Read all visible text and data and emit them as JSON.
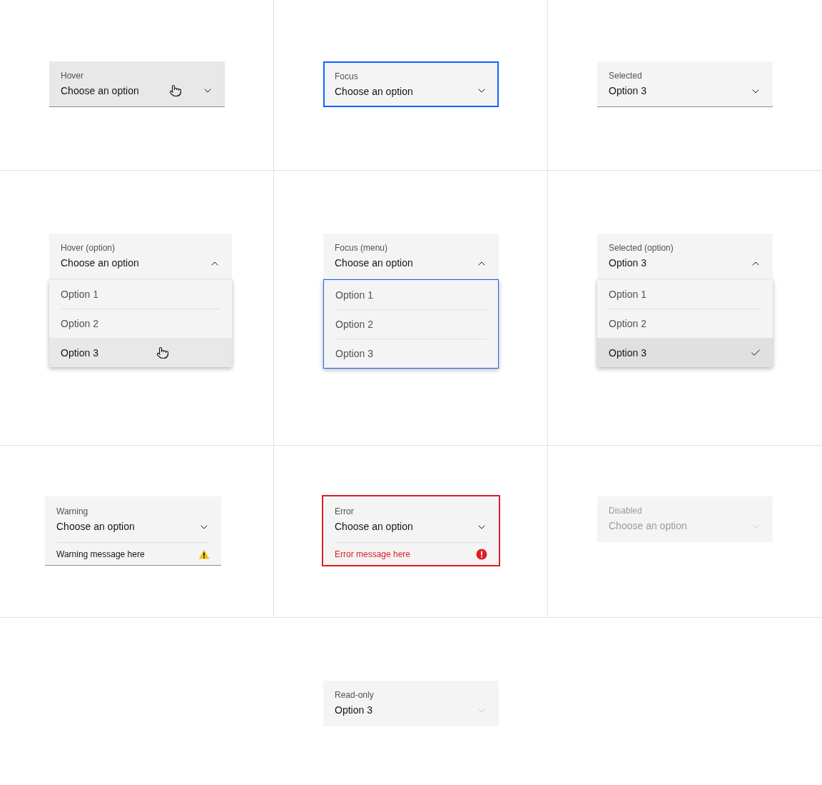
{
  "rows": [
    {
      "cells": [
        {
          "kind": "hover",
          "label": "Hover",
          "value": "Choose an option",
          "expanded": false,
          "cursor": true
        },
        {
          "kind": "focus",
          "label": "Focus",
          "value": "Choose an option",
          "expanded": false,
          "cursor": false
        },
        {
          "kind": "selected",
          "label": "Selected",
          "value": "Option 3",
          "expanded": false,
          "cursor": false
        }
      ]
    },
    {
      "cells": [
        {
          "kind": "hover-option",
          "label": "Hover (option)",
          "value": "Choose an option",
          "expanded": true,
          "cursor": false,
          "options": [
            {
              "label": "Option 1",
              "selected": false,
              "hovered": false
            },
            {
              "label": "Option 2",
              "selected": false,
              "hovered": false
            },
            {
              "label": "Option 3",
              "selected": false,
              "hovered": true
            }
          ]
        },
        {
          "kind": "focus-menu",
          "label": "Focus (menu)",
          "value": "Choose an option",
          "expanded": true,
          "cursor": false,
          "options": [
            {
              "label": "Option 1",
              "selected": false,
              "hovered": false
            },
            {
              "label": "Option 2",
              "selected": false,
              "hovered": false
            },
            {
              "label": "Option 3",
              "selected": false,
              "hovered": false
            }
          ]
        },
        {
          "kind": "selected-option",
          "label": "Selected (option)",
          "value": "Option 3",
          "expanded": true,
          "cursor": false,
          "options": [
            {
              "label": "Option 1",
              "selected": false,
              "hovered": false
            },
            {
              "label": "Option 2",
              "selected": false,
              "hovered": false
            },
            {
              "label": "Option 3",
              "selected": true,
              "hovered": false
            }
          ]
        }
      ]
    },
    {
      "cells": [
        {
          "kind": "warning",
          "label": "Warning",
          "value": "Choose an option",
          "expanded": false,
          "cursor": false,
          "message": "Warning message here"
        },
        {
          "kind": "error",
          "label": "Error",
          "value": "Choose an option",
          "expanded": false,
          "cursor": false,
          "message": "Error message here"
        },
        {
          "kind": "disabled",
          "label": "Disabled",
          "value": "Choose an option",
          "expanded": false,
          "cursor": false
        }
      ]
    },
    {
      "cells": [
        {
          "kind": "read-only",
          "label": "Read-only",
          "value": "Option 3",
          "expanded": false,
          "cursor": false
        }
      ]
    }
  ]
}
